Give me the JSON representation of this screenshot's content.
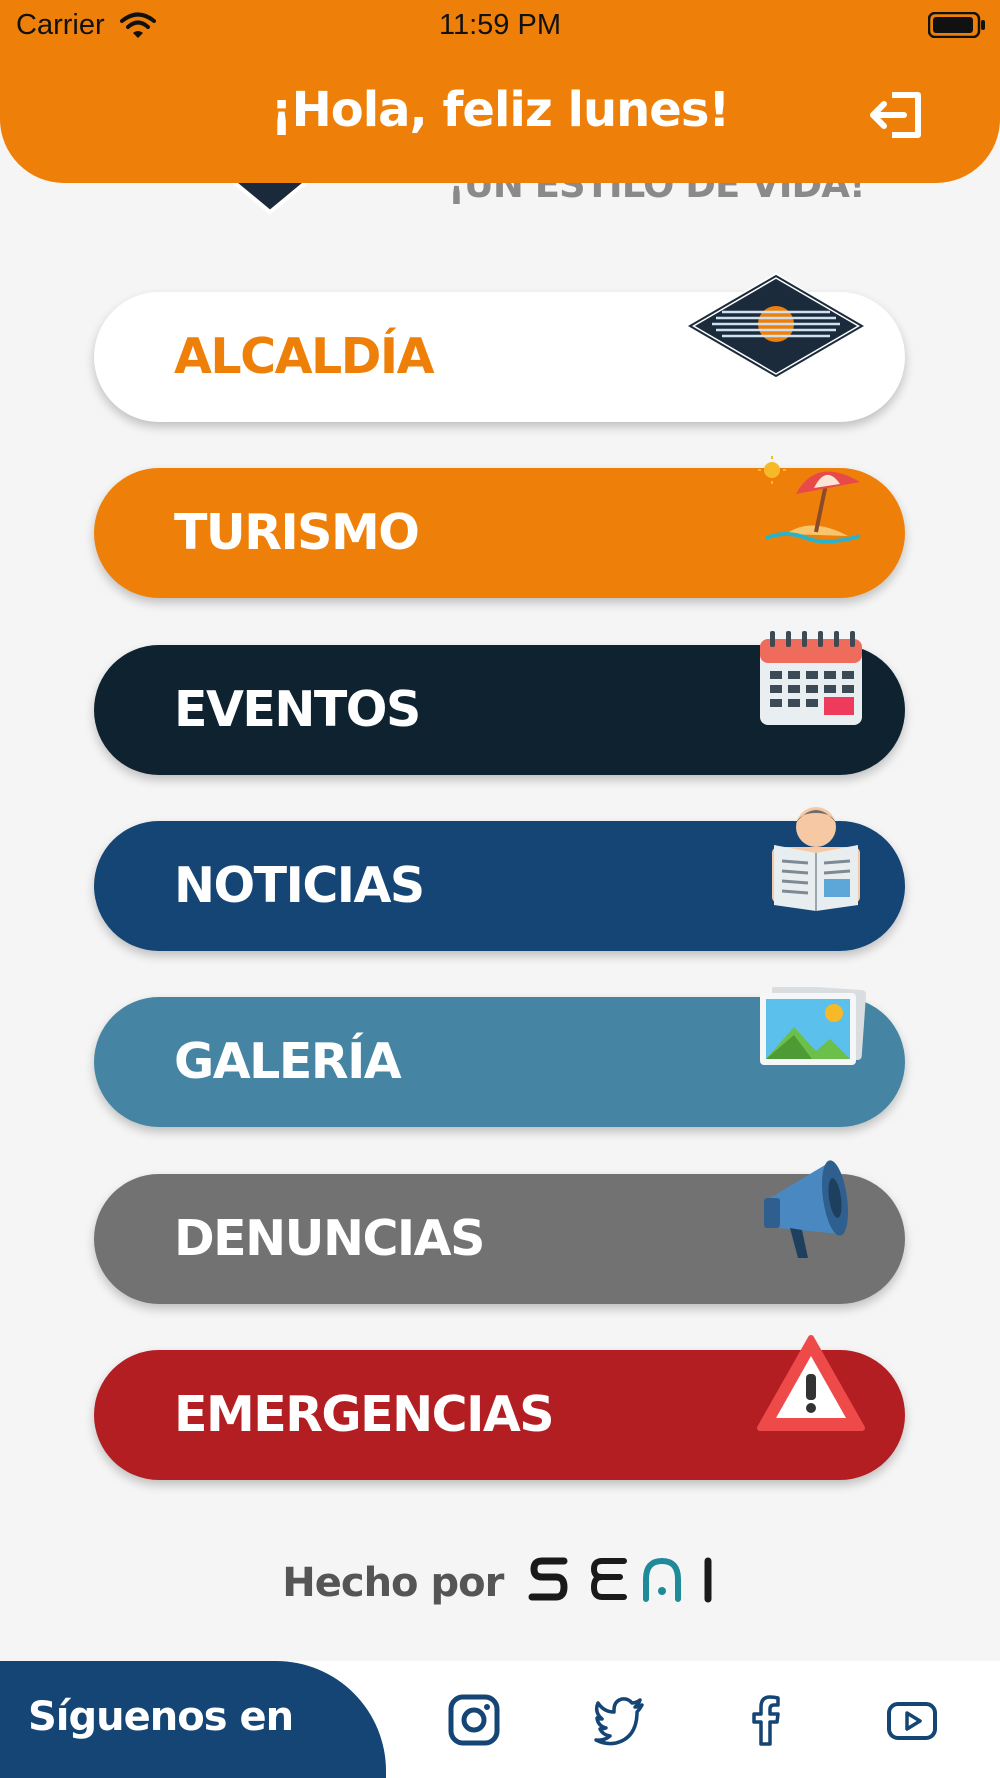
{
  "status_bar": {
    "carrier": "Carrier",
    "time": "11:59 PM"
  },
  "header": {
    "greeting": "¡Hola, feliz lunes!",
    "logout_icon": "logout-icon",
    "slogan": "¡UN ESTILO DE VIDA!"
  },
  "menu": {
    "items": [
      {
        "label": "ALCALDÍA",
        "icon": "city-hall-logo-icon",
        "color": "#ffffff",
        "text_color": "#ee8009"
      },
      {
        "label": "TURISMO",
        "icon": "beach-umbrella-icon",
        "color": "#ee8009"
      },
      {
        "label": "EVENTOS",
        "icon": "calendar-icon",
        "color": "#0e2230"
      },
      {
        "label": "NOTICIAS",
        "icon": "newspaper-reader-icon",
        "color": "#144574"
      },
      {
        "label": "GALERÍA",
        "icon": "picture-gallery-icon",
        "color": "#4584a3"
      },
      {
        "label": "DENUNCIAS",
        "icon": "megaphone-icon",
        "color": "#727272"
      },
      {
        "label": "EMERGENCIAS",
        "icon": "warning-triangle-icon",
        "color": "#b31e22"
      }
    ]
  },
  "footer": {
    "credit": "Hecho por",
    "brand": "SEAI",
    "follow_label": "Síguenos en",
    "social": [
      "instagram-icon",
      "twitter-icon",
      "facebook-icon",
      "youtube-icon"
    ]
  },
  "colors": {
    "accent": "#ee8009",
    "navy": "#144574",
    "background": "#f5f5f5"
  }
}
